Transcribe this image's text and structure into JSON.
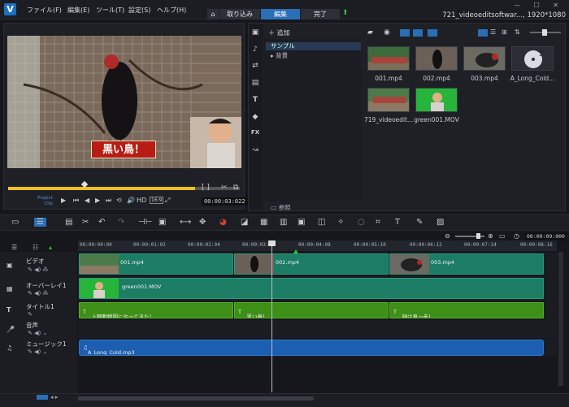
{
  "menu": [
    "ファイル(F)",
    "編集(E)",
    "ツール(T)",
    "設定(S)",
    "ヘルプ(H)"
  ],
  "mode_tabs": {
    "capture": "取り込み",
    "edit": "編集",
    "share": "完了"
  },
  "window_title": "721_videoeditsoftwar..., 1920*1080",
  "preview": {
    "caption": "黒い鳥！",
    "project_label": "Project",
    "clip_label": "Clip",
    "hd_label": "HD",
    "timecode": "00:00:03:022"
  },
  "library": {
    "add_label": "追加",
    "folders": [
      "サンプル",
      "背景"
    ],
    "browse_label": "参照",
    "media": [
      {
        "label": "001.mp4"
      },
      {
        "label": "002.mp4"
      },
      {
        "label": "003.mp4"
      },
      {
        "label": "A_Long_Cold..."
      },
      {
        "label": "719_videoedit..."
      },
      {
        "label": "green001.MOV"
      }
    ]
  },
  "timeline": {
    "timecode": "00:00:09:000",
    "ruler_ticks": [
      "00:00:00:00",
      "00:00:01:02",
      "00:00:02:04",
      "00:00:03:06",
      "00:00:04:08",
      "00:00:05:10",
      "00:00:06:12",
      "00:00:07:14",
      "00:00:08:16"
    ],
    "tracks": [
      {
        "name": "ビデオ",
        "icon": "video-track-icon"
      },
      {
        "name": "オーバーレイ1",
        "icon": "overlay-track-icon"
      },
      {
        "name": "タイトル1",
        "icon": "title-track-icon"
      },
      {
        "name": "音声",
        "icon": "voice-track-icon"
      },
      {
        "name": "ミュージック1",
        "icon": "music-track-icon"
      }
    ],
    "video_clips": [
      "001.mp4",
      "002.mp4",
      "003.mp4"
    ],
    "overlay_clip": "green001.MOV",
    "title_clips": [
      "上野動物園にやってきた！",
      "黒い鳥！",
      "顔は真っ赤！"
    ],
    "music_clip": "A_Long_Cold.mp3"
  },
  "colors": {
    "accent": "#2b6fb6",
    "scrub": "#f0c020",
    "video_clip": "#1d7d64",
    "title_clip": "#3d8f17",
    "music_clip": "#1c5fb0"
  }
}
